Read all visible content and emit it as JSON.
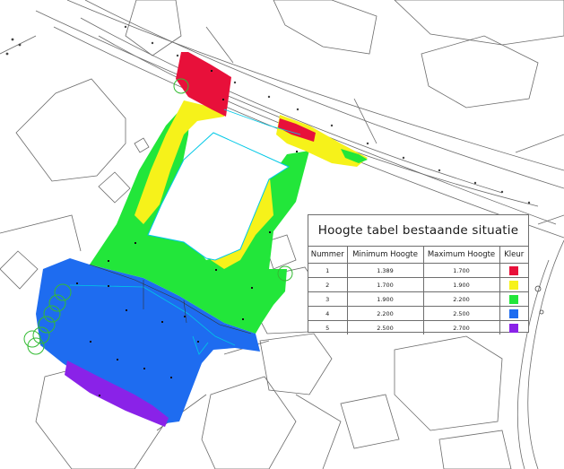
{
  "legend": {
    "title": "Hoogte tabel bestaande situatie",
    "headers": [
      "Nummer",
      "Minimum Hoogte",
      "Maximum Hoogte",
      "Kleur"
    ],
    "rows": [
      {
        "nummer": "1",
        "min": "1.389",
        "max": "1.700",
        "color": "#e8103a"
      },
      {
        "nummer": "2",
        "min": "1.700",
        "max": "1.900",
        "color": "#f6f21a"
      },
      {
        "nummer": "3",
        "min": "1.900",
        "max": "2.200",
        "color": "#22e63a"
      },
      {
        "nummer": "4",
        "min": "2.200",
        "max": "2.500",
        "color": "#1e6cf0"
      },
      {
        "nummer": "5",
        "min": "2.500",
        "max": "2.700",
        "color": "#8a22e8"
      }
    ]
  },
  "colors": {
    "linework": "#6b6b6b",
    "boundary": "#00c8e6",
    "tree": "#33bb33"
  }
}
